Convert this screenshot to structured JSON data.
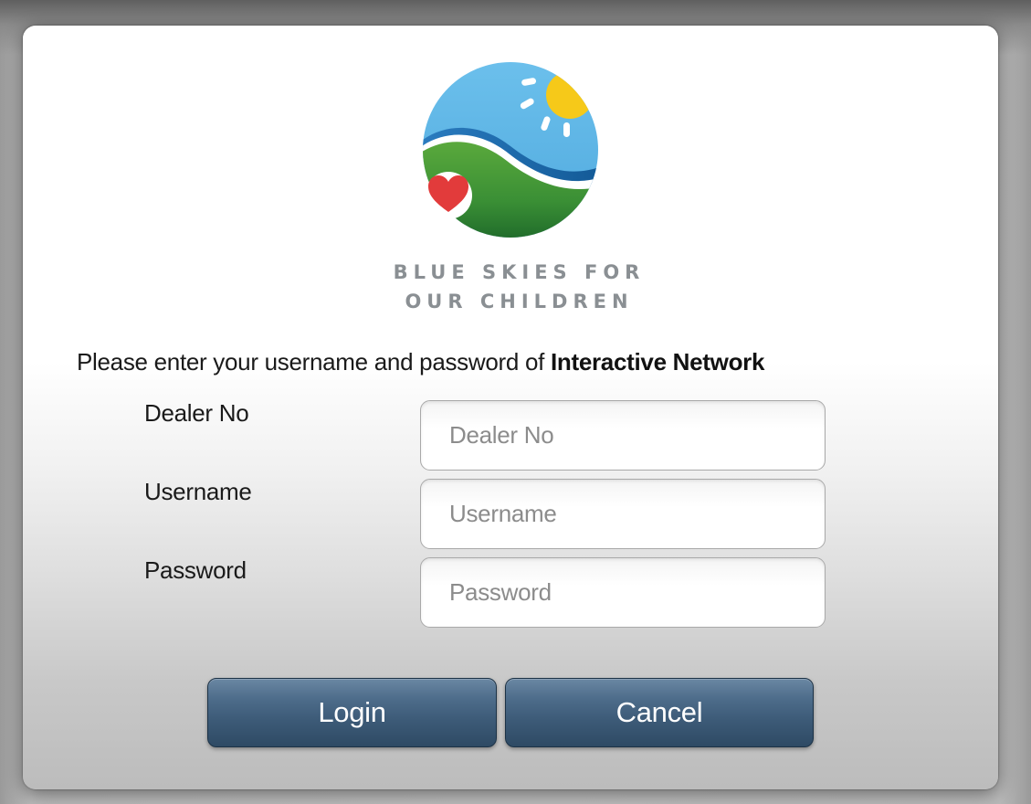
{
  "logo": {
    "name": "blue-skies-logo",
    "line1": "BLUE SKIES FOR",
    "line2": "OUR CHILDREN",
    "colors": {
      "sky": "#5bb4e6",
      "sun": "#f6c919",
      "hill": "#3c9a3e",
      "wave": "#1b6fb0",
      "heart": "#e23b3b",
      "text": "#8a8f93"
    }
  },
  "instruction": {
    "prefix": "Please enter your username and password of ",
    "emphasis": "Interactive Network"
  },
  "form": {
    "dealer_no": {
      "label": "Dealer No",
      "placeholder": "Dealer No",
      "value": ""
    },
    "username": {
      "label": "Username",
      "placeholder": "Username",
      "value": ""
    },
    "password": {
      "label": "Password",
      "placeholder": "Password",
      "value": ""
    }
  },
  "buttons": {
    "login": "Login",
    "cancel": "Cancel"
  },
  "theme": {
    "button_color": "#3d5b78",
    "dialog_background": "#ffffff",
    "backdrop": "#bdbdbd"
  }
}
